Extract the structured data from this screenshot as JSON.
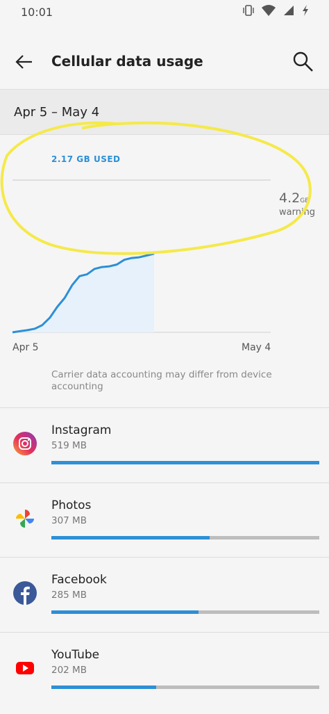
{
  "status_bar": {
    "time": "10:01",
    "icons": [
      "vibrate-icon",
      "wifi-icon",
      "signal-icon",
      "charging-icon"
    ]
  },
  "header": {
    "title": "Cellular data usage",
    "back_icon": "arrow-left-icon",
    "search_icon": "search-icon"
  },
  "cycle": {
    "label": "Apr 5 – May 4"
  },
  "usage": {
    "used_label": "2.17 GB USED",
    "warning_value": "4.2",
    "warning_unit": "GB",
    "warning_label": "warning",
    "x_start": "Apr 5",
    "x_end": "May 4",
    "note": "Carrier data accounting may differ from device accounting"
  },
  "chart_data": {
    "type": "area",
    "x_start": "Apr 5",
    "x_end": "May 4",
    "y_unit": "GB",
    "ylim": [
      0,
      4.2
    ],
    "warning_line": 4.2,
    "series": [
      {
        "values": [
          0.0,
          0.03,
          0.06,
          0.1,
          0.2,
          0.4,
          0.7,
          0.95,
          1.3,
          1.55,
          1.6,
          1.75,
          1.8,
          1.82,
          1.87,
          2.0,
          2.05,
          2.07,
          2.12,
          2.17
        ]
      }
    ],
    "colors": {
      "line": "#2d8fd6",
      "fill": "#e6f1fb",
      "baseline": "#cfcfcf"
    }
  },
  "apps": [
    {
      "name": "Instagram",
      "size": "519 MB",
      "fraction": 1.0,
      "icon": "instagram-icon"
    },
    {
      "name": "Photos",
      "size": "307 MB",
      "fraction": 0.59,
      "icon": "photos-icon"
    },
    {
      "name": "Facebook",
      "size": "285 MB",
      "fraction": 0.55,
      "icon": "facebook-icon"
    },
    {
      "name": "YouTube",
      "size": "202 MB",
      "fraction": 0.39,
      "icon": "youtube-icon"
    }
  ],
  "annotation": {
    "color": "#f5e94a"
  }
}
